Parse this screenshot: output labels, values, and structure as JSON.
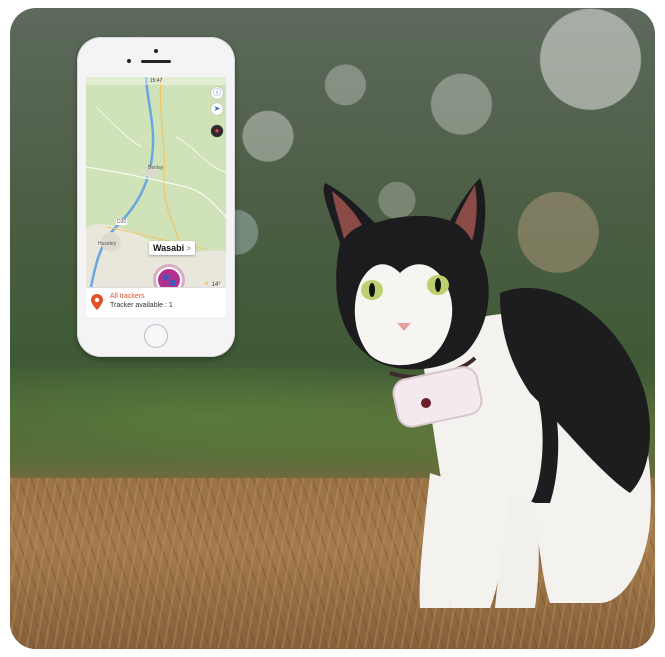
{
  "phone": {
    "status_time": "15:47",
    "map": {
      "town_north": "Benlay",
      "town_west": "Huseley",
      "road_badge": "D30",
      "temperature": "14°",
      "weather_icon": "cloud-sun-icon"
    },
    "pet": {
      "name": "Wasabi",
      "chevron": ">",
      "marker_icon": "paw-icon",
      "marker_color": "#b2308f"
    },
    "panel": {
      "title": "All trackers",
      "subtitle": "Tracker available : 1",
      "pin_color": "#e2502a"
    }
  },
  "photo": {
    "subject": "cat-wearing-tracker"
  }
}
